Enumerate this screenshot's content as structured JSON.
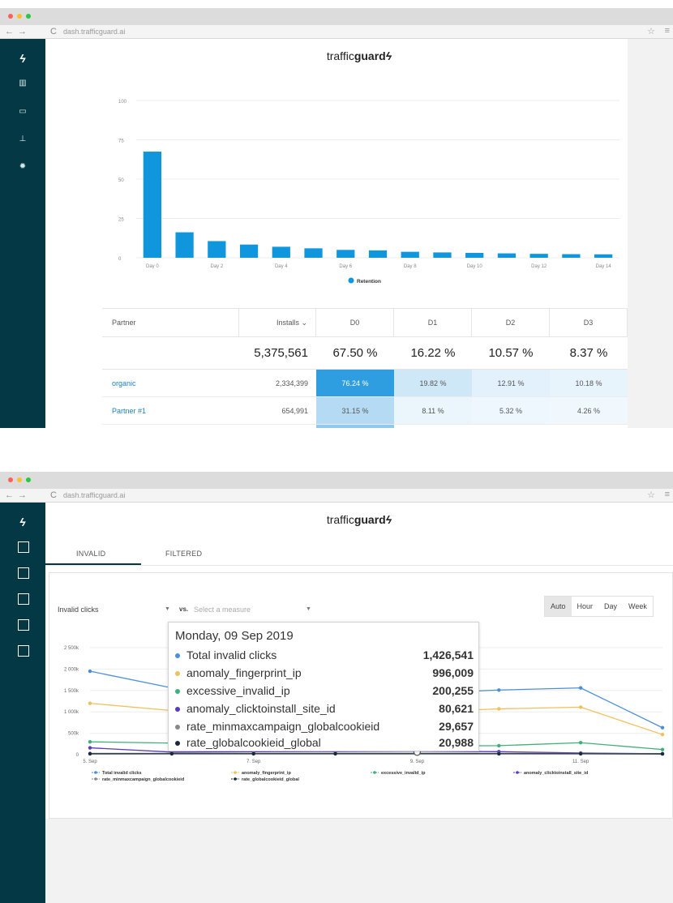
{
  "browser": {
    "url": "dash.trafficguard.ai"
  },
  "brand": {
    "prefix": "traffic",
    "bold": "guard"
  },
  "colors": {
    "sidebar": "#033844",
    "bar": "#0f96dc"
  },
  "retention": {
    "legend": "Retention",
    "table": {
      "headers": [
        "Partner",
        "Installs ⌄",
        "D0",
        "D1",
        "D2",
        "D3"
      ],
      "totals": {
        "installs": "5,375,561",
        "d0": "67.50 %",
        "d1": "16.22 %",
        "d2": "10.57 %",
        "d3": "8.37 %"
      },
      "rows": [
        {
          "partner": "organic",
          "installs": "2,334,399",
          "d0": "76.24 %",
          "d1": "19.82 %",
          "d2": "12.91 %",
          "d3": "10.18 %"
        },
        {
          "partner": "Partner #1",
          "installs": "654,991",
          "d0": "31.15 %",
          "d1": "8.11 %",
          "d2": "5.32 %",
          "d3": "4.26 %"
        }
      ]
    }
  },
  "invalid": {
    "tabs": [
      "INVALID",
      "FILTERED"
    ],
    "measure": "Invalid clicks",
    "vs_label": "vs.",
    "compare_placeholder": "Select a measure",
    "intervals": [
      "Auto",
      "Hour",
      "Day",
      "Week"
    ],
    "active_interval": "Auto",
    "tooltip": {
      "title": "Monday, 09 Sep 2019",
      "rows": [
        {
          "name": "Total invalid clicks",
          "value": "1,426,541",
          "color": "#4a90d9"
        },
        {
          "name": "anomaly_fingerprint_ip",
          "value": "996,009",
          "color": "#f0c05a"
        },
        {
          "name": "excessive_invalid_ip",
          "value": "200,255",
          "color": "#3fb07a"
        },
        {
          "name": "anomaly_clicktoinstall_site_id",
          "value": "80,621",
          "color": "#5b3bb8"
        },
        {
          "name": "rate_minmaxcampaign_globalcookieid",
          "value": "29,657",
          "color": "#888888"
        },
        {
          "name": "rate_globalcookieid_global",
          "value": "20,988",
          "color": "#1a2a3a"
        }
      ]
    }
  },
  "chart_data": [
    {
      "type": "bar",
      "categories": [
        "Day 0",
        "Day 1",
        "Day 2",
        "Day 3",
        "Day 4",
        "Day 5",
        "Day 6",
        "Day 7",
        "Day 8",
        "Day 9",
        "Day 10",
        "Day 11",
        "Day 12",
        "Day 13",
        "Day 14"
      ],
      "tick_labels": [
        "Day 0",
        "Day 2",
        "Day 4",
        "Day 6",
        "Day 8",
        "Day 10",
        "Day 12",
        "Day 14"
      ],
      "values": [
        67.5,
        16.2,
        10.6,
        8.4,
        7.0,
        6.0,
        5.0,
        4.7,
        3.8,
        3.4,
        3.1,
        2.8,
        2.5,
        2.3,
        2.2
      ],
      "series": [
        {
          "name": "Retention",
          "color": "#0f96dc"
        }
      ],
      "ylim": [
        0,
        100
      ],
      "yticks": [
        0,
        25,
        50,
        75,
        100
      ],
      "grid": true,
      "legend": "bottom"
    },
    {
      "type": "line",
      "x": [
        "5 Sep",
        "6 Sep",
        "7 Sep",
        "8 Sep",
        "9 Sep",
        "10 Sep",
        "11 Sep",
        "12 Sep"
      ],
      "tick_labels": [
        "5. Sep",
        "7. Sep",
        "9. Sep",
        "11. Sep"
      ],
      "ylim": [
        0,
        2500000
      ],
      "yticks": [
        0,
        500000,
        1000000,
        1500000,
        2000000,
        2500000
      ],
      "ytick_labels": [
        "0",
        "500k",
        "1 000k",
        "1 500k",
        "2 000k",
        "2 500k"
      ],
      "grid": true,
      "legend": "bottom",
      "series": [
        {
          "name": "Total invalid clicks",
          "color": "#4a90d9",
          "values": [
            1950000,
            1560000,
            1480000,
            1440000,
            1426541,
            1510000,
            1560000,
            630000
          ]
        },
        {
          "name": "anomaly_fingerprint_ip",
          "color": "#f0c05a",
          "values": [
            1200000,
            1030000,
            1010000,
            1000000,
            996009,
            1070000,
            1110000,
            470000
          ]
        },
        {
          "name": "excessive_invalid_ip",
          "color": "#3fb07a",
          "values": [
            300000,
            270000,
            240000,
            220000,
            200255,
            210000,
            280000,
            120000
          ]
        },
        {
          "name": "anomaly_clicktoinstall_site_id",
          "color": "#5b3bb8",
          "values": [
            160000,
            60000,
            70000,
            75000,
            80621,
            70000,
            40000,
            20000
          ]
        },
        {
          "name": "rate_minmaxcampaign_globalcookieid",
          "color": "#888888",
          "values": [
            30000,
            30000,
            30000,
            30000,
            29657,
            30000,
            30000,
            25000
          ]
        },
        {
          "name": "rate_globalcookieid_global",
          "color": "#1a2a3a",
          "values": [
            20000,
            21000,
            21000,
            21000,
            20988,
            21000,
            21000,
            18000
          ]
        }
      ]
    }
  ]
}
